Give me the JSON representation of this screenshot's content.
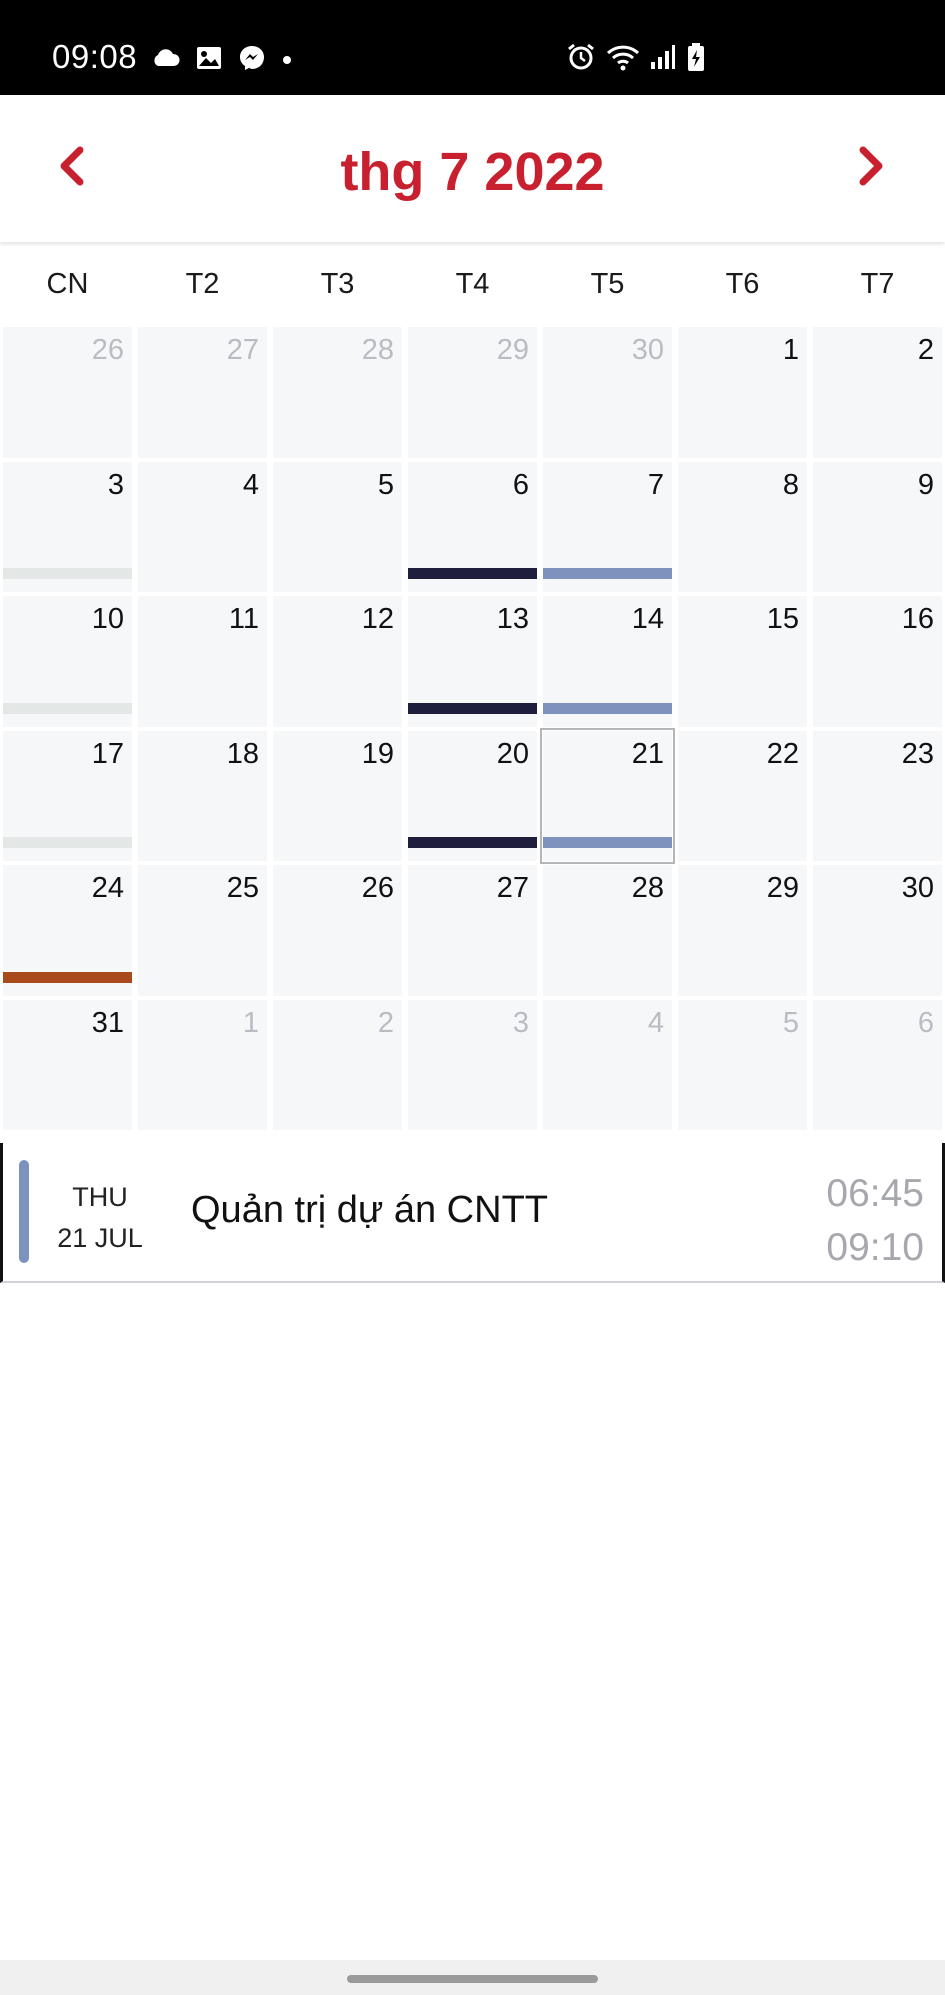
{
  "status_bar": {
    "time": "09:08",
    "left_icons": [
      "cloud-icon",
      "image-icon",
      "messenger-icon",
      "dot-icon"
    ],
    "right_icons": [
      "alarm-icon",
      "wifi-icon",
      "signal-icon",
      "battery-charging-icon"
    ]
  },
  "header": {
    "title": "thg 7 2022",
    "prev_icon": "chevron-left-icon",
    "next_icon": "chevron-right-icon",
    "accent_color": "#c8202f"
  },
  "weekdays": [
    "CN",
    "T2",
    "T3",
    "T4",
    "T5",
    "T6",
    "T7"
  ],
  "days": [
    {
      "n": "26",
      "other": true
    },
    {
      "n": "27",
      "other": true
    },
    {
      "n": "28",
      "other": true
    },
    {
      "n": "29",
      "other": true
    },
    {
      "n": "30",
      "other": true
    },
    {
      "n": "1"
    },
    {
      "n": "2"
    },
    {
      "n": "3",
      "bar": "#e3e8e6"
    },
    {
      "n": "4"
    },
    {
      "n": "5"
    },
    {
      "n": "6",
      "bar": "#1f1f3d"
    },
    {
      "n": "7",
      "bar": "#7d92bd"
    },
    {
      "n": "8"
    },
    {
      "n": "9"
    },
    {
      "n": "10",
      "bar": "#e3e8e6"
    },
    {
      "n": "11"
    },
    {
      "n": "12"
    },
    {
      "n": "13",
      "bar": "#1f1f3d"
    },
    {
      "n": "14",
      "bar": "#7d92bd"
    },
    {
      "n": "15"
    },
    {
      "n": "16"
    },
    {
      "n": "17",
      "bar": "#e3e8e6"
    },
    {
      "n": "18"
    },
    {
      "n": "19"
    },
    {
      "n": "20",
      "bar": "#1f1f3d"
    },
    {
      "n": "21",
      "bar": "#7d92bd",
      "selected": true
    },
    {
      "n": "22"
    },
    {
      "n": "23"
    },
    {
      "n": "24",
      "bar": "#a94a1c"
    },
    {
      "n": "25"
    },
    {
      "n": "26"
    },
    {
      "n": "27"
    },
    {
      "n": "28"
    },
    {
      "n": "29"
    },
    {
      "n": "30"
    },
    {
      "n": "31"
    },
    {
      "n": "1",
      "other": true
    },
    {
      "n": "2",
      "other": true
    },
    {
      "n": "3",
      "other": true
    },
    {
      "n": "4",
      "other": true
    },
    {
      "n": "5",
      "other": true
    },
    {
      "n": "6",
      "other": true
    }
  ],
  "event": {
    "weekday": "THU",
    "date": "21 JUL",
    "title": "Quản trị dự án CNTT",
    "start": "06:45",
    "end": "09:10",
    "color": "#7d92bd"
  }
}
